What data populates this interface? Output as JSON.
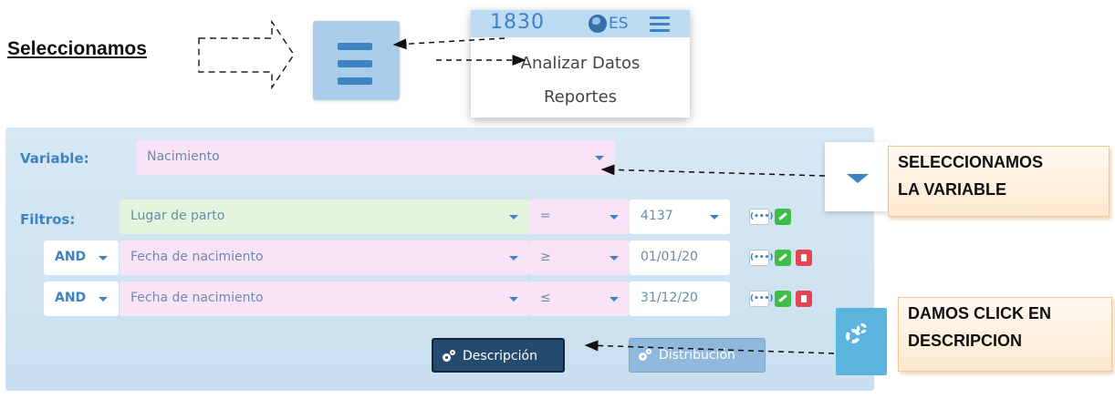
{
  "annotations": {
    "select_label": "Seleccionamos",
    "note_variable_line1": "SELECCIONAMOS",
    "note_variable_line2": "LA VARIABLE",
    "note_click_line1": "DAMOS CLICK EN",
    "note_click_line2": "DESCRIPCION"
  },
  "menu_dropdown": {
    "number": "1830",
    "language": "ES",
    "items": [
      "Analizar Datos",
      "Reportes"
    ]
  },
  "form": {
    "variable_label": "Variable:",
    "variable_value": "Nacimiento",
    "filters_label": "Filtros:",
    "filters": [
      {
        "connector": "",
        "field": "Lugar de parto",
        "operator": "=",
        "value": "4137"
      },
      {
        "connector": "AND",
        "field": "Fecha de nacimiento",
        "operator": "≥",
        "value": "01/01/20"
      },
      {
        "connector": "AND",
        "field": "Fecha de nacimiento",
        "operator": "≤",
        "value": "31/12/20"
      }
    ],
    "dots_label": "(•••)",
    "btn_description": "Descripción",
    "btn_distribution": "Distribución"
  },
  "colors": {
    "accent": "#3f82c3",
    "panel": "#d8e8f5",
    "pink_field": "#f9e4f7",
    "green_field": "#e4f5de",
    "note_fill": "#fde8cf"
  },
  "icons": [
    "hamburger-menu-icon",
    "globe-icon",
    "chevron-down-icon",
    "cogs-icon",
    "edit-icon",
    "trash-icon",
    "dots-icon"
  ]
}
